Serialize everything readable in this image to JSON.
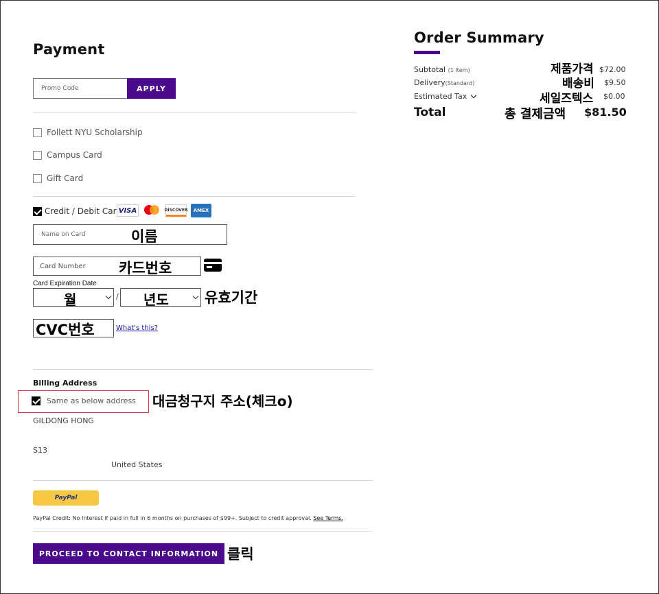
{
  "payment": {
    "title": "Payment",
    "promo_placeholder": "Promo Code",
    "apply_label": "APPLY",
    "options": [
      "Follett NYU Scholarship",
      "Campus Card",
      "Gift Card"
    ],
    "credit_label": "Credit / Debit Card",
    "card_logos": [
      "VISA",
      "mastercard",
      "DISCOVER",
      "AMEX"
    ],
    "name_placeholder": "Name on Card",
    "name_annotation": "이름",
    "card_number_placeholder": "Card Number",
    "card_number_annotation": "카드번호",
    "expiration_label": "Card Expiration Date",
    "month_value": "월",
    "year_value": "년도",
    "expiration_separator": "/",
    "expiration_annotation": "유효기간",
    "cvc_value": "CVC번호",
    "whats_this": "What's this?"
  },
  "billing": {
    "title": "Billing Address",
    "same_as_label": "Same as below address",
    "same_as_annotation": "대금청구지 주소(체크o)",
    "name": "GILDONG HONG",
    "line2": "S13",
    "country": "United States"
  },
  "paypal": {
    "button_label": "PayPal",
    "credit_text": "PayPal Credit: No Interest if paid in full in 6 months on purchases of $99+. Subject to credit approval.",
    "see_terms": "See Terms."
  },
  "proceed": {
    "label": "PROCEED TO CONTACT INFORMATION",
    "annotation": "클릭"
  },
  "summary": {
    "title": "Order Summary",
    "subtotal_label": "Subtotal",
    "subtotal_items": "(1 Item)",
    "subtotal_annotation": "제품가격",
    "subtotal_value": "$72.00",
    "delivery_label": "Delivery",
    "delivery_type": "(Standard)",
    "delivery_annotation": "배송비",
    "delivery_value": "$9.50",
    "tax_label": "Estimated Tax",
    "tax_annotation": "세일즈텍스",
    "tax_value": "$0.00",
    "total_label": "Total",
    "total_annotation": "총 결제금액",
    "total_value": "$81.50"
  },
  "colors": {
    "accent": "#4b0a8c",
    "paypal_yellow": "#f7c643",
    "highlight_red": "#d9363e"
  }
}
